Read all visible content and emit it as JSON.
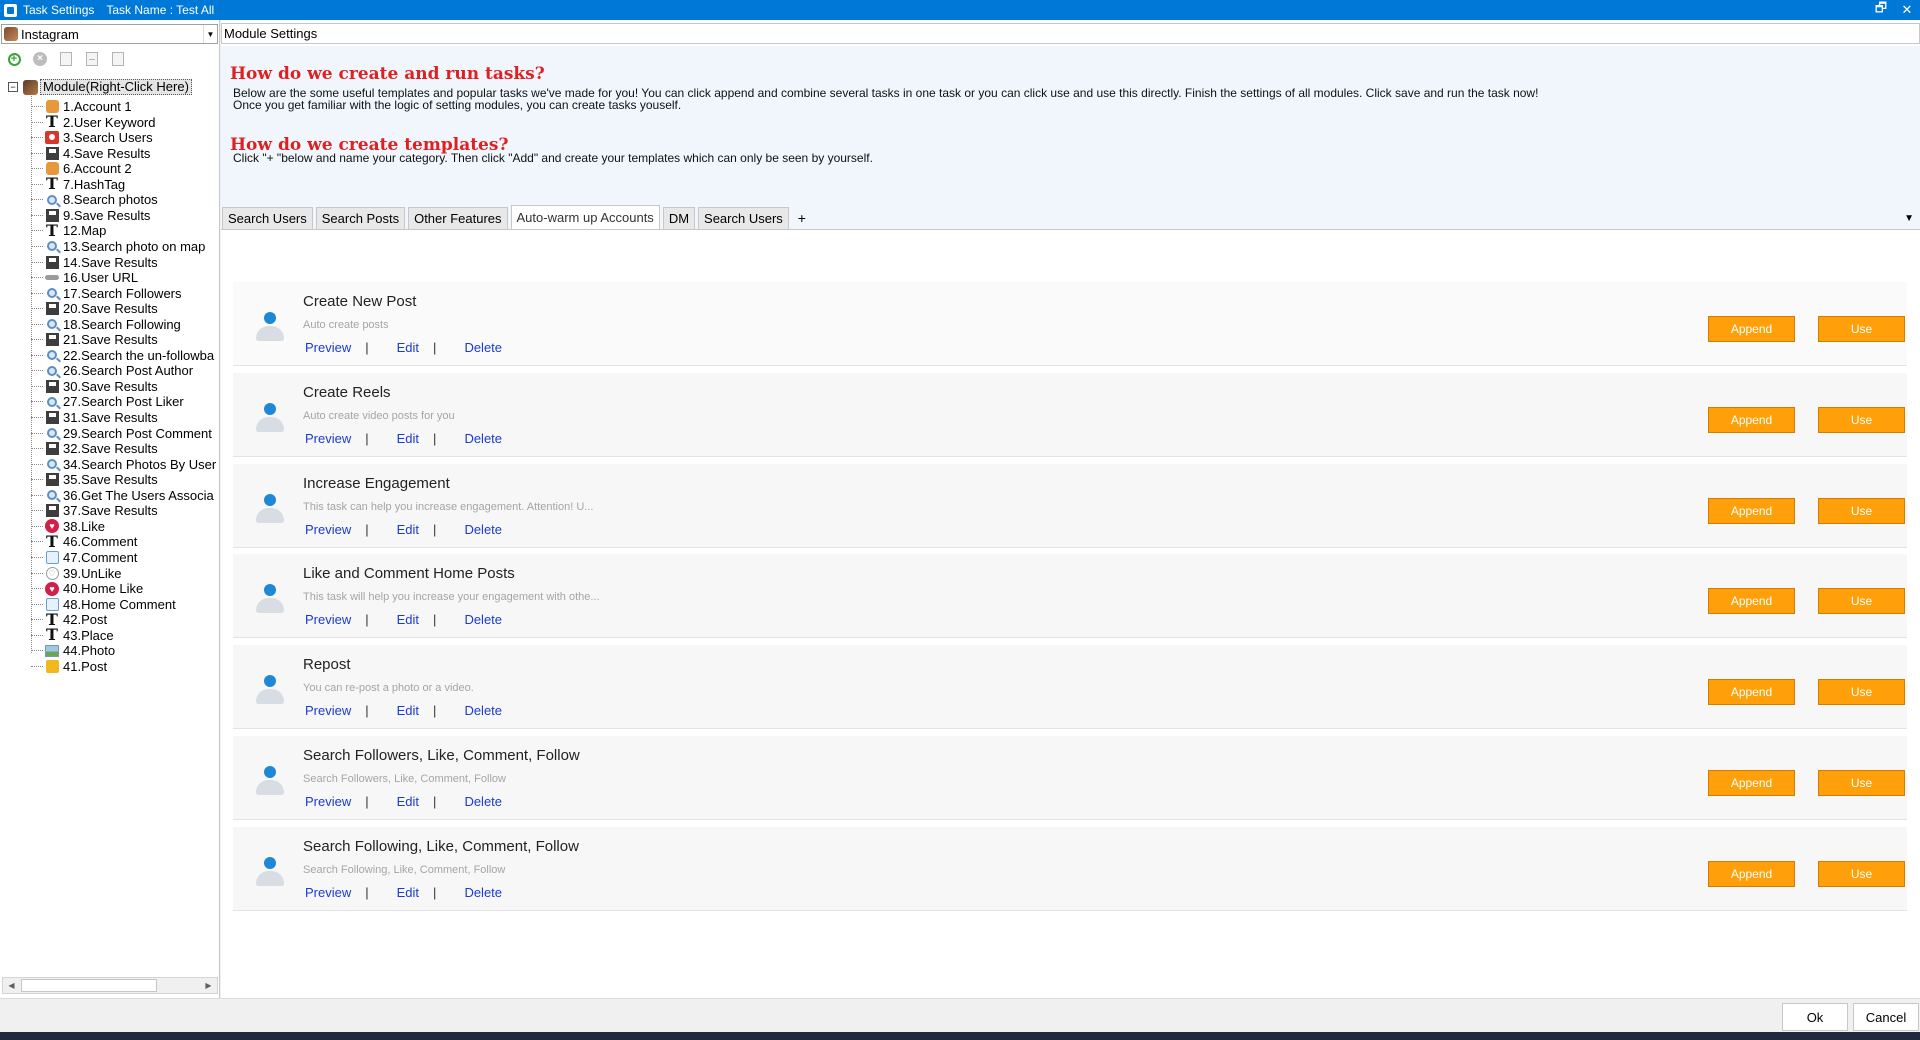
{
  "titlebar": {
    "title": "Task Settings",
    "task_name": "Task Name : Test All",
    "restore_symbol": "🗗",
    "close_symbol": "✕"
  },
  "left_panel": {
    "platform": "Instagram",
    "root_label": "Module(Right-Click Here)",
    "root_expander": "−",
    "items": [
      {
        "label": "1.Account 1",
        "icon": "account-icon"
      },
      {
        "label": "2.User Keyword",
        "icon": "text-icon"
      },
      {
        "label": "3.Search Users",
        "icon": "users-icon"
      },
      {
        "label": "4.Save Results",
        "icon": "save-icon"
      },
      {
        "label": "6.Account 2",
        "icon": "account-icon"
      },
      {
        "label": "7.HashTag",
        "icon": "text-icon"
      },
      {
        "label": "8.Search photos",
        "icon": "search-icon"
      },
      {
        "label": "9.Save Results",
        "icon": "save-icon"
      },
      {
        "label": "12.Map",
        "icon": "text-icon"
      },
      {
        "label": "13.Search photo on map",
        "icon": "search-icon"
      },
      {
        "label": "14.Save Results",
        "icon": "save-icon"
      },
      {
        "label": "16.User URL",
        "icon": "url-icon"
      },
      {
        "label": "17.Search Followers",
        "icon": "search-icon"
      },
      {
        "label": "20.Save Results",
        "icon": "save-icon"
      },
      {
        "label": "18.Search Following",
        "icon": "search-icon"
      },
      {
        "label": "21.Save Results",
        "icon": "save-icon"
      },
      {
        "label": "22.Search the un-followba",
        "icon": "search-icon"
      },
      {
        "label": "26.Search Post Author",
        "icon": "search-icon"
      },
      {
        "label": "30.Save Results",
        "icon": "save-icon"
      },
      {
        "label": "27.Search Post Liker",
        "icon": "search-icon"
      },
      {
        "label": "31.Save Results",
        "icon": "save-icon"
      },
      {
        "label": "29.Search Post Comment",
        "icon": "search-icon"
      },
      {
        "label": "32.Save Results",
        "icon": "save-icon"
      },
      {
        "label": "34.Search Photos By User",
        "icon": "search-icon"
      },
      {
        "label": "35.Save Results",
        "icon": "save-icon"
      },
      {
        "label": "36.Get The Users Associa",
        "icon": "search-icon"
      },
      {
        "label": "37.Save Results",
        "icon": "save-icon"
      },
      {
        "label": "38.Like",
        "icon": "like-icon"
      },
      {
        "label": "46.Comment",
        "icon": "text-icon"
      },
      {
        "label": "47.Comment",
        "icon": "comment-icon"
      },
      {
        "label": "39.UnLike",
        "icon": "unlike-icon"
      },
      {
        "label": "40.Home Like",
        "icon": "like-icon"
      },
      {
        "label": "48.Home Comment",
        "icon": "comment-icon"
      },
      {
        "label": "42.Post",
        "icon": "text-icon"
      },
      {
        "label": "43.Place",
        "icon": "text-icon"
      },
      {
        "label": "44.Photo",
        "icon": "photo-icon"
      },
      {
        "label": "41.Post",
        "icon": "post-icon"
      }
    ]
  },
  "right_panel": {
    "module_settings": "Module Settings",
    "info": {
      "heading1": "How do we create and run tasks?",
      "text1_line1": "Below are the some useful templates and popular tasks we've made for you!  You can click append and combine several tasks in one task or you can click use and use this directly. Finish the settings of all modules. Click save and run the task now!",
      "text1_line2": "Once you get familiar with the logic of setting modules, you can create tasks youself.",
      "heading2": "How do we create templates?",
      "text2": "Click \"+ \"below and name your category. Then click \"Add\" and create your templates which can only be seen by yourself."
    },
    "tabs": [
      "Search Users",
      "Search Posts",
      "Other Features",
      "Auto-warm up Accounts",
      "DM",
      "Search Users"
    ],
    "active_tab_index": 3,
    "tab_add": "+",
    "tabs_dropdown": "▼",
    "link_labels": {
      "preview": "Preview",
      "edit": "Edit",
      "delete": "Delete",
      "separator": "|"
    },
    "button_labels": {
      "append": "Append",
      "use": "Use"
    },
    "templates": [
      {
        "title": "Create New Post",
        "description": "Auto create posts"
      },
      {
        "title": "Create Reels",
        "description": "Auto create video posts for you"
      },
      {
        "title": "Increase Engagement",
        "description": "This task can help you increase engagement. Attention!  U..."
      },
      {
        "title": "Like and Comment Home Posts",
        "description": "This task will help you increase your engagement with othe..."
      },
      {
        "title": "Repost",
        "description": "You can re-post a photo or a video."
      },
      {
        "title": "Search Followers, Like, Comment, Follow",
        "description": "Search Followers, Like, Comment, Follow"
      },
      {
        "title": "Search Following, Like, Comment, Follow",
        "description": "Search Following, Like, Comment, Follow"
      }
    ]
  },
  "footer": {
    "ok": "Ok",
    "cancel": "Cancel"
  },
  "colors": {
    "titlebar": "#0078d7",
    "heading": "#e02020",
    "link": "#1a3bcf",
    "button": "#ff9f0a"
  }
}
